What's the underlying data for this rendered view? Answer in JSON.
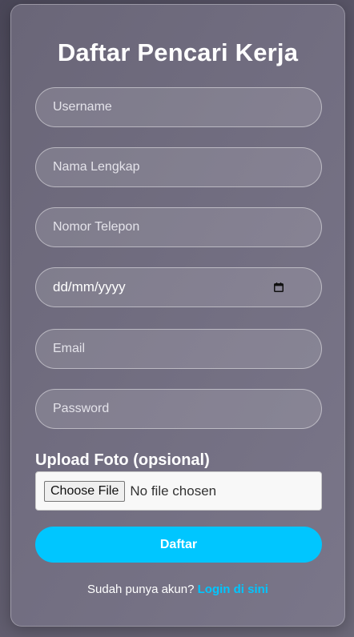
{
  "form": {
    "title": "Daftar Pencari Kerja",
    "fields": [
      {
        "placeholder": "Username"
      },
      {
        "placeholder": "Nama Lengkap"
      },
      {
        "placeholder": "Nomor Telepon"
      },
      {
        "value": "dd/mm/yyyy"
      },
      {
        "placeholder": "Email"
      },
      {
        "placeholder": "Password"
      }
    ],
    "upload_label": "Upload Foto (opsional)",
    "file_button": "Choose File",
    "file_status": "No file chosen",
    "submit_label": "Daftar",
    "footer_text": "Sudah punya akun?",
    "footer_link": "Login di sini"
  },
  "colors": {
    "accent": "#00c6ff"
  },
  "icons": {
    "date_picker": "calendar-icon"
  }
}
